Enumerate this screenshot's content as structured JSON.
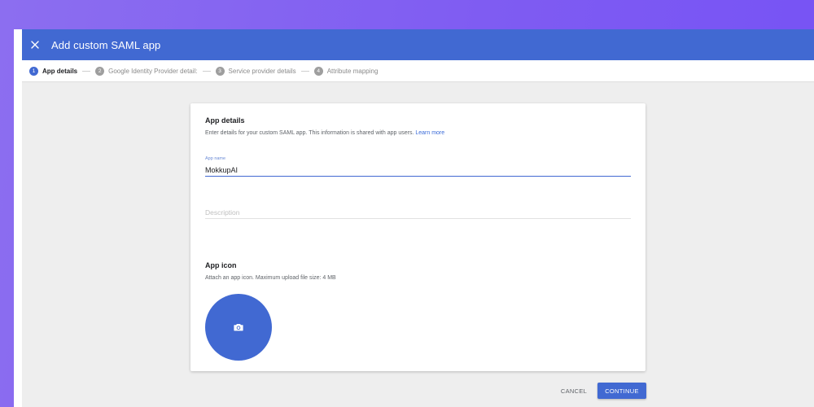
{
  "header": {
    "title": "Add custom SAML app",
    "close_icon": "close-icon"
  },
  "stepper": {
    "steps": [
      {
        "number": "1",
        "label": "App details",
        "active": true
      },
      {
        "number": "2",
        "label": "Google Identity Provider detail:",
        "active": false
      },
      {
        "number": "3",
        "label": "Service provider details",
        "active": false
      },
      {
        "number": "4",
        "label": "Attribute mapping",
        "active": false
      }
    ]
  },
  "app_details": {
    "title": "App details",
    "description": "Enter details for your custom SAML app. This information is shared with app users.",
    "learn_more": "Learn more",
    "app_name_label": "App name",
    "app_name_value": "MokkupAI",
    "description_placeholder": "Description"
  },
  "app_icon": {
    "title": "App icon",
    "description": "Attach an app icon. Maximum upload file size: 4 MB",
    "upload_icon": "camera-icon"
  },
  "footer": {
    "cancel_label": "CANCEL",
    "continue_label": "CONTINUE"
  },
  "colors": {
    "primary": "#4169d2",
    "background": "#eeeeee",
    "gradient_left": "#8c6ef0",
    "gradient_right": "#7652f5"
  }
}
